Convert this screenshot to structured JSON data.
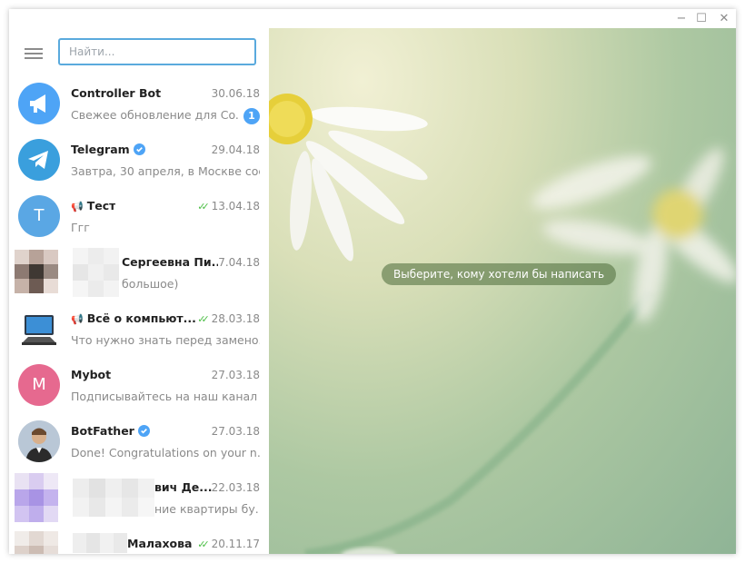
{
  "window": {
    "controls": [
      "minimize-icon",
      "maximize-icon",
      "close-icon"
    ],
    "control_glyphs": {
      "minimize": "−",
      "maximize": "☐",
      "close": "✕"
    }
  },
  "sidebar": {
    "menu_icon": "hamburger-icon",
    "search": {
      "placeholder": "Найти...",
      "value": ""
    },
    "chats": [
      {
        "name": "Controller Bot",
        "date": "30.06.18",
        "preview": "Свежее обновление для Co...",
        "badge": "1",
        "avatar": "megaphone-icon",
        "avatar_color": "#4ea4f6"
      },
      {
        "name": "Telegram",
        "date": "29.04.18",
        "preview": "Завтра, 30 апреля, в Москве сос...",
        "verified": true,
        "avatar": "telegram-logo-icon",
        "avatar_color": "#3a9fdd"
      },
      {
        "name": "Тест",
        "date": "13.04.18",
        "preview": "Ггг",
        "channel": true,
        "read": true,
        "avatar_letter": "T",
        "avatar_color": "#5aa7e4"
      },
      {
        "name": "Сергеевна Пи...",
        "date": "7.04.18",
        "preview": "большое)",
        "pixelated": true
      },
      {
        "name": "Всё о компьют...",
        "date": "28.03.18",
        "preview": "Что нужно знать перед замено...",
        "channel": true,
        "read": true,
        "avatar": "computer-icon"
      },
      {
        "name": "Mybot",
        "date": "27.03.18",
        "preview": "Подписывайтесь на наш канал ...",
        "avatar_letter": "M",
        "avatar_color": "#e6698f"
      },
      {
        "name": "BotFather",
        "date": "27.03.18",
        "preview": "Done! Congratulations on your n...",
        "verified": true,
        "avatar": "botfather-avatar"
      },
      {
        "name": "вич Де...",
        "date": "22.03.18",
        "preview": "ние квартиры бу...",
        "pixelated": true
      },
      {
        "name": "Малахова",
        "date": "20.11.17",
        "preview": "",
        "read": true,
        "pixelated": true
      }
    ]
  },
  "main": {
    "hint": "Выберите, кому хотели бы написать"
  },
  "colors": {
    "accent": "#5aaadd",
    "badge": "#4ea4f6",
    "check": "#4dbf47"
  }
}
